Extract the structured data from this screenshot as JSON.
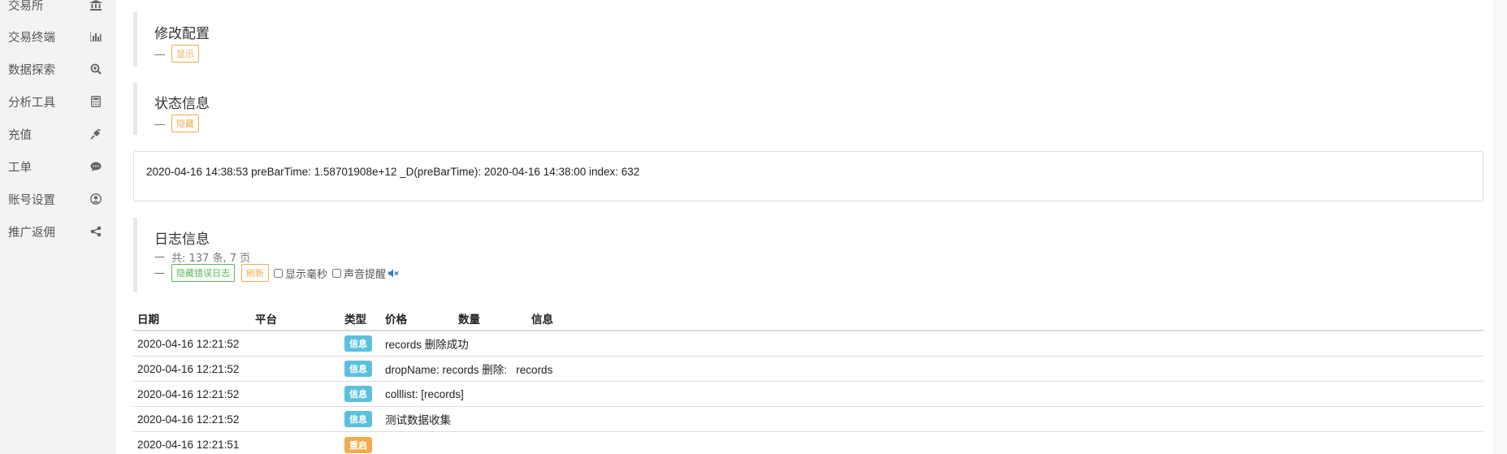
{
  "sidebar": {
    "items": [
      {
        "label": "交易所",
        "icon": "bank-icon"
      },
      {
        "label": "交易终端",
        "icon": "bar-chart-icon"
      },
      {
        "label": "数据探索",
        "icon": "search-plus-icon"
      },
      {
        "label": "分析工具",
        "icon": "calculator-icon"
      },
      {
        "label": "充值",
        "icon": "plug-icon"
      },
      {
        "label": "工单",
        "icon": "comment-icon"
      },
      {
        "label": "账号设置",
        "icon": "user-circle-icon"
      },
      {
        "label": "推广返佣",
        "icon": "share-icon"
      }
    ]
  },
  "config_panel": {
    "title": "修改配置",
    "dash": "—",
    "button": "显示"
  },
  "status_panel": {
    "title": "状态信息",
    "dash": "—",
    "button": "隐藏"
  },
  "status_text": "2020-04-16 14:38:53 preBarTime: 1.58701908e+12 _D(preBarTime): 2020-04-16 14:38:00 index: 632",
  "log_panel": {
    "title": "日志信息",
    "dash": "—",
    "summary": "共: 137 条, 7 页",
    "hide_error_button": "隐藏错误日志",
    "refresh_button": "刷新",
    "show_ms_label": "显示毫秒",
    "sound_label": "声音提醒",
    "sound_icon": "volume-mute-icon"
  },
  "log_table": {
    "headers": {
      "date": "日期",
      "platform": "平台",
      "type": "类型",
      "price": "价格",
      "quantity": "数量",
      "info": "信息"
    },
    "rows": [
      {
        "date": "2020-04-16 12:21:52",
        "platform": "",
        "type": "信息",
        "type_color": "#5bc0de",
        "price": "",
        "quantity": "",
        "info": "records 删除成功"
      },
      {
        "date": "2020-04-16 12:21:52",
        "platform": "",
        "type": "信息",
        "type_color": "#5bc0de",
        "price": "",
        "quantity": "",
        "info": "dropName: records 删除:   records"
      },
      {
        "date": "2020-04-16 12:21:52",
        "platform": "",
        "type": "信息",
        "type_color": "#5bc0de",
        "price": "",
        "quantity": "",
        "info": "colllist: [records]"
      },
      {
        "date": "2020-04-16 12:21:52",
        "platform": "",
        "type": "信息",
        "type_color": "#5bc0de",
        "price": "",
        "quantity": "",
        "info": "测试数据收集"
      },
      {
        "date": "2020-04-16 12:21:51",
        "platform": "",
        "type": "重启",
        "type_color": "#f0ad4e",
        "price": "",
        "quantity": "",
        "info": ""
      }
    ]
  }
}
